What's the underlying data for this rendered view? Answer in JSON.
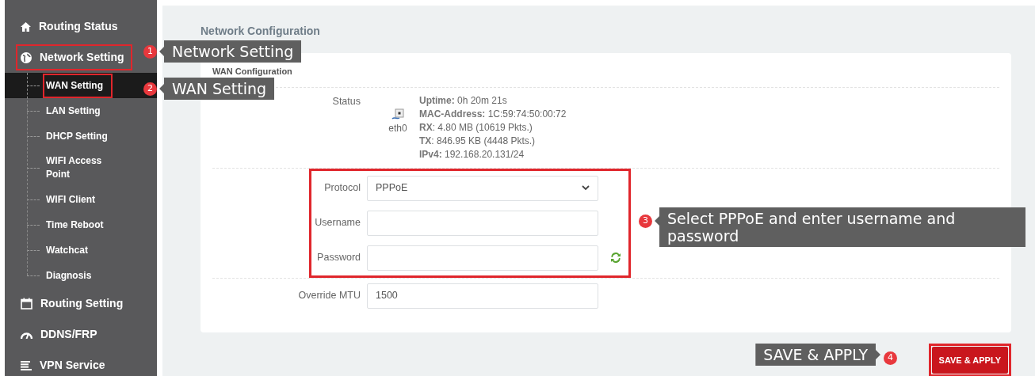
{
  "sidebar": {
    "items": [
      {
        "label": "Routing Status",
        "highlighted": false
      },
      {
        "label": "Network Setting",
        "highlighted": true,
        "children": [
          {
            "label": "WAN Setting",
            "selected": true,
            "highlighted": true
          },
          {
            "label": "LAN Setting",
            "selected": false,
            "highlighted": false
          },
          {
            "label": "DHCP Setting",
            "selected": false,
            "highlighted": false
          },
          {
            "label": "WIFI Access Point",
            "selected": false,
            "highlighted": false
          },
          {
            "label": "WIFI Client",
            "selected": false,
            "highlighted": false
          },
          {
            "label": "Time Reboot",
            "selected": false,
            "highlighted": false
          },
          {
            "label": "Watchcat",
            "selected": false,
            "highlighted": false
          },
          {
            "label": "Diagnosis",
            "selected": false,
            "highlighted": false
          }
        ]
      },
      {
        "label": "Routing Setting",
        "highlighted": false
      },
      {
        "label": "DDNS/FRP",
        "highlighted": false
      },
      {
        "label": "VPN Service",
        "highlighted": false
      }
    ]
  },
  "page_title": "Network Configuration",
  "section_title": "WAN Configuration",
  "status": {
    "label": "Status",
    "device": "eth0",
    "lines": [
      "**Uptime:** 0h 20m 21s",
      "**MAC-Address:** 1C:59:74:50:00:72",
      "**RX**: 4.80 MB (10619 Pkts.)",
      "**TX**: 846.95 KB (4448 Pkts.)",
      "**IPv4:** 192.168.20.131/24"
    ]
  },
  "fields": [
    {
      "kind": "select",
      "label": "Protocol",
      "value": "PPPoE",
      "highlighted": true
    },
    {
      "kind": "text",
      "label": "Username",
      "highlighted": true
    },
    {
      "kind": "password",
      "label": "Password",
      "highlighted": true
    },
    {
      "kind": "text",
      "label": "Override MTU",
      "value": "1500",
      "highlighted": false
    }
  ],
  "save_button": {
    "label": "SAVE & APPLY",
    "highlighted": true
  },
  "annotations": [
    {
      "number": "1",
      "text": "Network Setting"
    },
    {
      "number": "2",
      "text": "WAN Setting"
    },
    {
      "number": "3",
      "text": "Select PPPoE and enter username and password"
    },
    {
      "number": "4",
      "text": "SAVE & APPLY"
    }
  ]
}
